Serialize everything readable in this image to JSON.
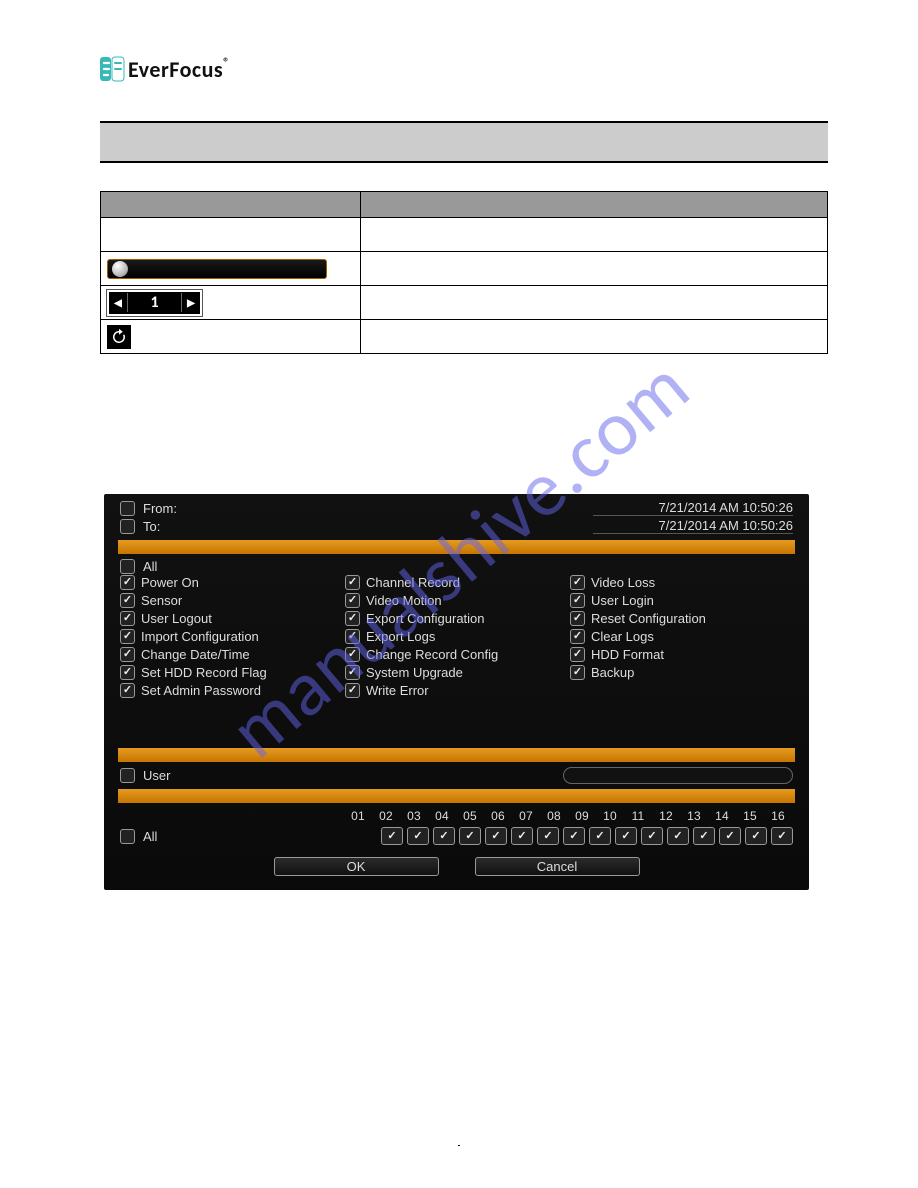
{
  "watermark": "manualshive.com",
  "brand": {
    "name": "EverFocus",
    "reg": "®"
  },
  "controls_table": {
    "stepper_value": "1"
  },
  "dvr": {
    "from_label": "From:",
    "to_label": "To:",
    "from_value": "7/21/2014 AM 10:50:26",
    "to_value": "7/21/2014 AM 10:50:26",
    "all_label": "All",
    "events_col1": [
      "Power On",
      "Sensor",
      "User Logout",
      "Import Configuration",
      "Change Date/Time",
      "Set HDD Record Flag",
      "Set Admin Password"
    ],
    "events_col2": [
      "Channel Record",
      "Video Motion",
      "Export Configuration",
      "Export Logs",
      "Change Record Config",
      "System Upgrade",
      "Write Error"
    ],
    "events_col3": [
      "Video Loss",
      "User Login",
      "Reset Configuration",
      "Clear Logs",
      "HDD Format",
      "Backup",
      ""
    ],
    "user_label": "User",
    "channels": [
      "01",
      "02",
      "03",
      "04",
      "05",
      "06",
      "07",
      "08",
      "09",
      "10",
      "11",
      "12",
      "13",
      "14",
      "15",
      "16"
    ],
    "all_ch_label": "All",
    "ok_label": "OK",
    "cancel_label": "Cancel"
  },
  "page_number": ""
}
